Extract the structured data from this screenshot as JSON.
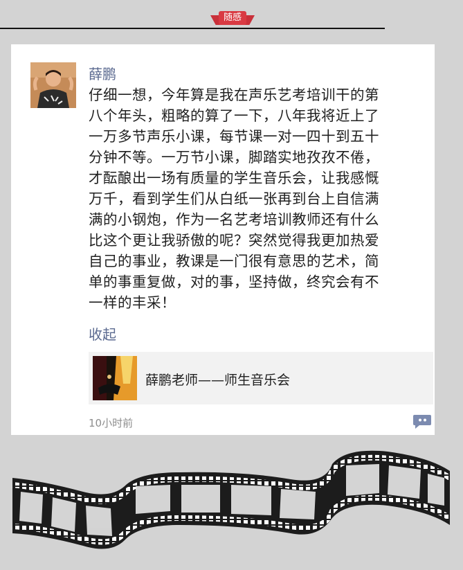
{
  "header": {
    "tag": "随感"
  },
  "post": {
    "author": "薛鹏",
    "text": "仔细一想，今年算是我在声乐艺考培训干的第\n八个年头，粗略的算了一下，八年我将近上了\n一万多节声乐小课，每节课一对一四十到五十\n分钟不等。一万节小课，脚踏实地孜孜不倦，\n才酝酿出一场有质量的学生音乐会，让我感慨\n万千，看到学生们从白纸一张再到台上自信满\n满的小钢炮，作为一名艺考培训教师还有什么\n比这个更让我骄傲的呢？突然觉得我更加热爱\n自己的事业，教课是一门很有意思的艺术，简\n单的事重复做，对的事，坚持做，终究会有不\n一样的丰采！",
    "collapse_label": "收起",
    "link_title": "薛鹏老师——师生音乐会",
    "timestamp": "10小时前"
  },
  "colors": {
    "accent_red": "#d93a43",
    "name_blue": "#5b6a90",
    "background": "#d3d3d3"
  },
  "icons": {
    "comment": "comment-bubble-icon",
    "thumbnail": "concert-stage-image",
    "decoration": "film-strip"
  }
}
